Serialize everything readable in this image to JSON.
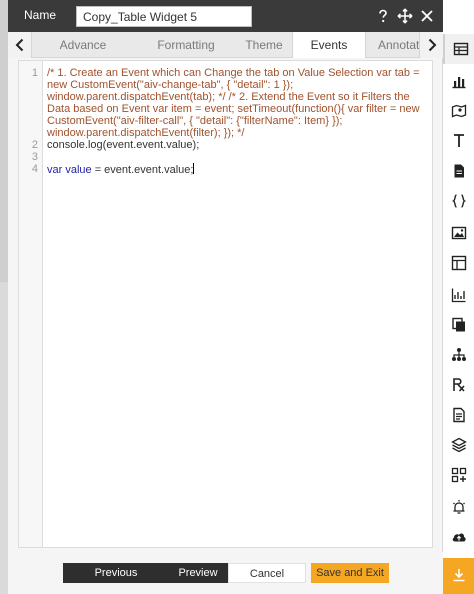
{
  "header": {
    "name_label": "Name",
    "name_value": "Copy_Table Widget 5",
    "icons": [
      "help-icon",
      "move-icon",
      "close-icon"
    ]
  },
  "tabs": [
    {
      "label": "Advance",
      "active": false
    },
    {
      "label": "Formatting",
      "active": false
    },
    {
      "label": "Theme",
      "active": false
    },
    {
      "label": "Events",
      "active": true
    },
    {
      "label": "Annotat",
      "active": false
    }
  ],
  "editor": {
    "line_numbers": [
      "1",
      "2",
      "3",
      "4"
    ],
    "line1": "/* 1. Create an Event which can Change the tab on Value Selection var tab = new CustomEvent(\"aiv-change-tab\", {    \"detail\": 1 }); window.parent.dispatchEvent(tab);  */ /* 2. Extend the Event so it Filters the Data based on Event var item = event; setTimeout(function(){ var filter = new CustomEvent(\"aiv-filter-call\", {    \"detail\": {\"filterName\": Item} }); window.parent.dispatchEvent(filter); }); */",
    "line2": "console.log(event.event.value);",
    "line3": "",
    "line4_kw": "var",
    "line4_var": " value",
    "line4_rest": " = event.event.value;"
  },
  "footer": {
    "previous": "Previous",
    "preview": "Preview",
    "cancel": "Cancel",
    "save_exit": "Save and Exit"
  },
  "rail": {
    "icons": [
      "table-icon",
      "bar-chart-icon",
      "map-icon",
      "text-icon",
      "document-icon",
      "braces-icon",
      "image-icon",
      "dashboard-icon",
      "line-chart-icon",
      "copy-icon",
      "hierarchy-icon",
      "rx-icon",
      "report-icon",
      "layers-icon",
      "add-widget-icon",
      "alert-icon",
      "upload-icon",
      "download-icon"
    ]
  },
  "colors": {
    "header_bg": "#3a3a3a",
    "accent": "#f5a623",
    "comment": "#a0522d",
    "keyword": "#2323aa"
  }
}
